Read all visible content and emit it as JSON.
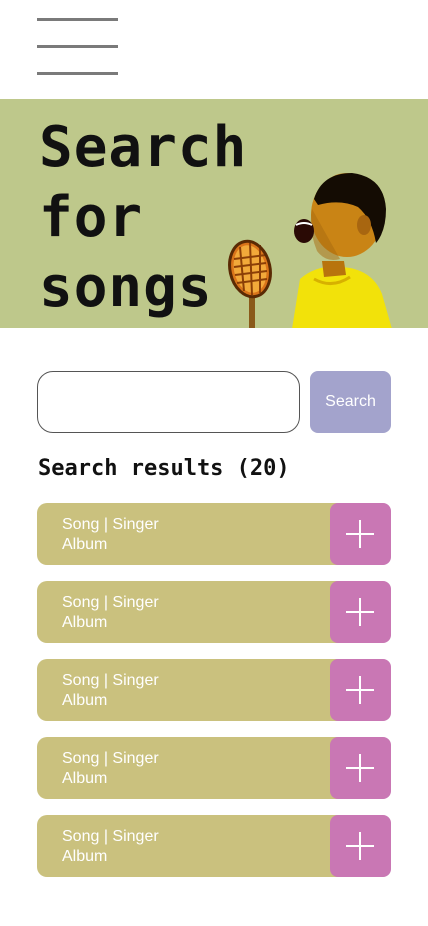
{
  "menu": {
    "icon": "hamburger-menu-icon"
  },
  "hero": {
    "title_line1": "Search",
    "title_line2": "for",
    "title_line3": "songs",
    "background": "#bec88b",
    "art": "singer-with-microphone-image"
  },
  "search": {
    "value": "",
    "placeholder": "",
    "button_label": "Search",
    "button_color": "#a3a3cc"
  },
  "results": {
    "title_prefix": "Search results (",
    "count": "20",
    "title_suffix": ")",
    "item_color": "#cac17e",
    "add_color": "#c977b4",
    "add_icon": "plus-icon",
    "items": [
      {
        "line1": "Song | Singer",
        "line2": "Album"
      },
      {
        "line1": "Song | Singer",
        "line2": "Album"
      },
      {
        "line1": "Song | Singer",
        "line2": "Album"
      },
      {
        "line1": "Song | Singer",
        "line2": "Album"
      },
      {
        "line1": "Song | Singer",
        "line2": "Album"
      }
    ]
  }
}
